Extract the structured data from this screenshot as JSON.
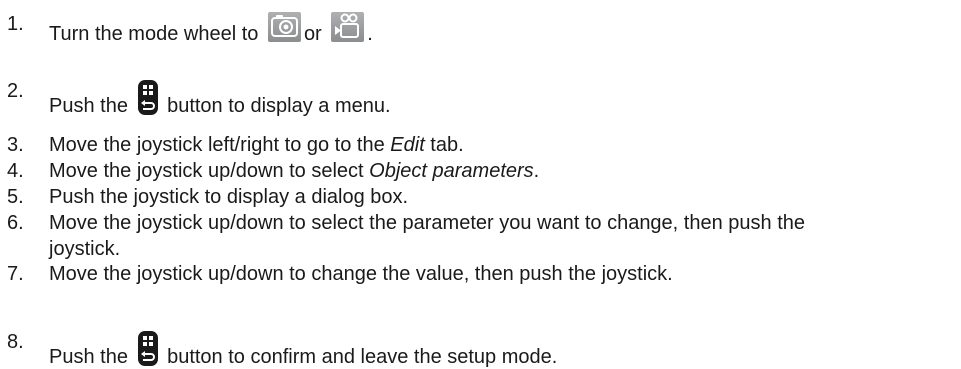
{
  "steps": [
    {
      "num": "1.",
      "before": "Turn the mode wheel to ",
      "or": "or ",
      "after": "."
    },
    {
      "num": "2.",
      "before": "Push the ",
      "after": " button to display a menu."
    },
    {
      "num": "3.",
      "before": "Move the joystick left/right to go to the ",
      "em": "Edit",
      "after": " tab."
    },
    {
      "num": "4.",
      "before": "Move the joystick up/down to select ",
      "em": "Object parameters",
      "after": "."
    },
    {
      "num": "5.",
      "text": "Push the joystick to display a dialog box."
    },
    {
      "num": "6.",
      "text": "Move the joystick up/down to select the parameter you want to change, then push the",
      "cont": "joystick."
    },
    {
      "num": "7.",
      "text": "Move the joystick up/down to change the value, then push the joystick."
    },
    {
      "num": "8.",
      "before": "Push the ",
      "after": " button to confirm and leave the setup mode."
    }
  ],
  "icons": {
    "photo_mode": "camera-photo-mode-icon",
    "video_mode": "video-camera-mode-icon",
    "menu_back_button": "menu-back-button-icon"
  },
  "colors": {
    "text": "#1a1a1a",
    "mode_icon_bg": "#9c9ea0",
    "button_icon": "#1a1a1a"
  }
}
